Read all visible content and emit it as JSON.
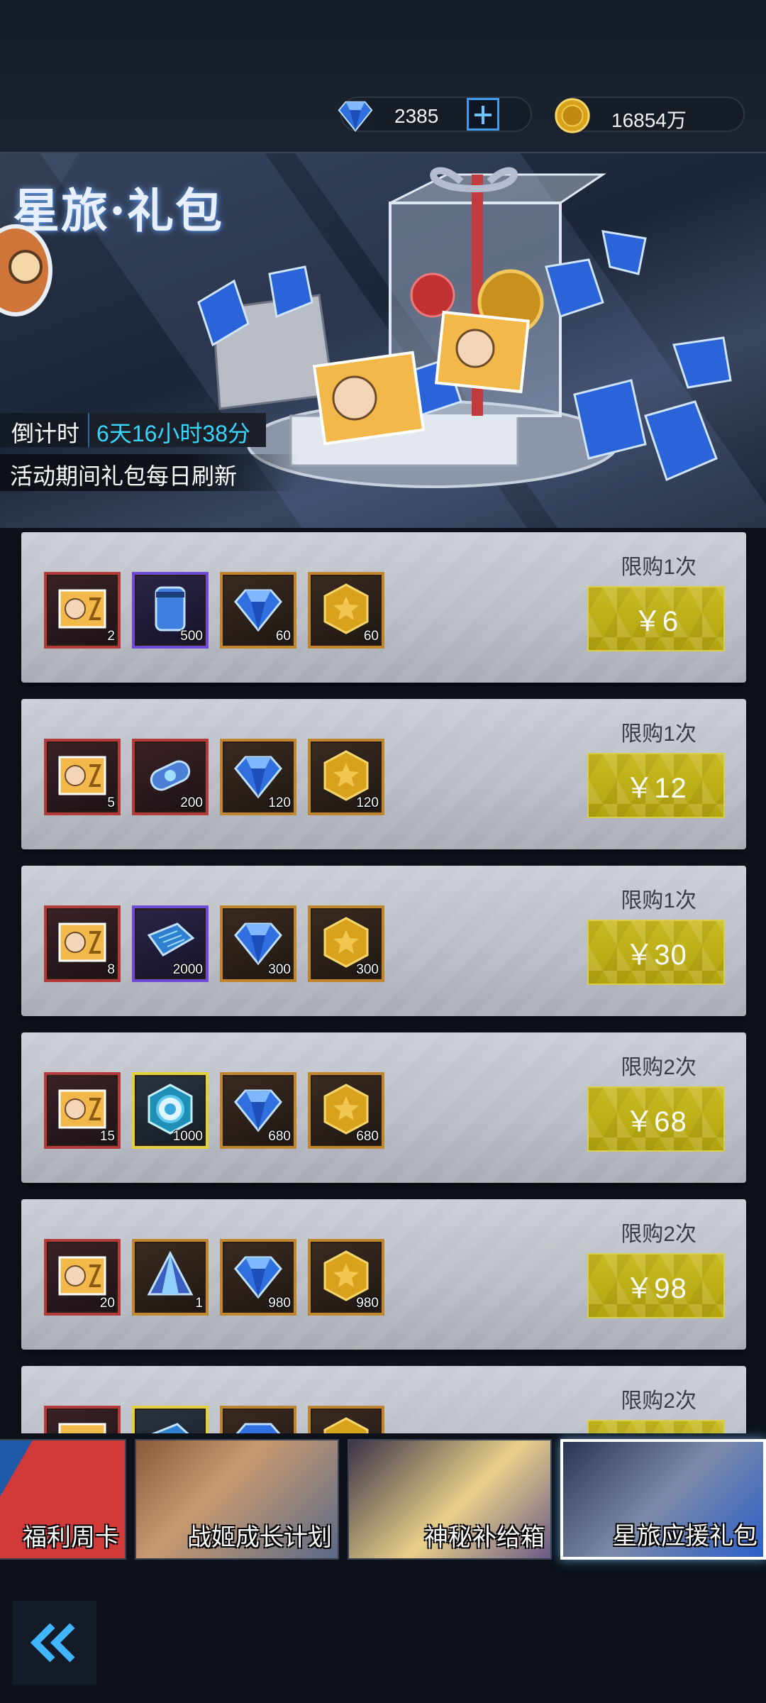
{
  "currency": {
    "gems": "2385",
    "gold": "16854万"
  },
  "banner": {
    "title": "星旅·礼包",
    "countdown_label": "倒计时",
    "countdown_value": "6天16小时38分",
    "refresh_note": "活动期间礼包每日刷新"
  },
  "packs": [
    {
      "limit": "限购1次",
      "price": "￥6",
      "items": [
        {
          "icon": "ticket-icon",
          "qty": "2"
        },
        {
          "icon": "energy-canister-icon",
          "qty": "500"
        },
        {
          "icon": "diamond-icon",
          "qty": "60"
        },
        {
          "icon": "gold-hexagon-icon",
          "qty": "60"
        }
      ]
    },
    {
      "limit": "限购1次",
      "price": "￥12",
      "items": [
        {
          "icon": "ticket-icon",
          "qty": "5"
        },
        {
          "icon": "capsule-icon",
          "qty": "200"
        },
        {
          "icon": "diamond-icon",
          "qty": "120"
        },
        {
          "icon": "gold-hexagon-icon",
          "qty": "120"
        }
      ]
    },
    {
      "limit": "限购1次",
      "price": "￥30",
      "items": [
        {
          "icon": "ticket-icon",
          "qty": "8"
        },
        {
          "icon": "chip-board-icon",
          "qty": "2000"
        },
        {
          "icon": "diamond-icon",
          "qty": "300"
        },
        {
          "icon": "gold-hexagon-icon",
          "qty": "300"
        }
      ]
    },
    {
      "limit": "限购2次",
      "price": "￥68",
      "items": [
        {
          "icon": "ticket-icon",
          "qty": "15"
        },
        {
          "icon": "core-orb-icon",
          "qty": "1000"
        },
        {
          "icon": "diamond-icon",
          "qty": "680"
        },
        {
          "icon": "gold-hexagon-icon",
          "qty": "680"
        }
      ]
    },
    {
      "limit": "限购2次",
      "price": "￥98",
      "items": [
        {
          "icon": "ticket-icon",
          "qty": "20"
        },
        {
          "icon": "crystal-prism-icon",
          "qty": "1"
        },
        {
          "icon": "diamond-icon",
          "qty": "980"
        },
        {
          "icon": "gold-hexagon-icon",
          "qty": "980"
        }
      ]
    },
    {
      "limit": "限购2次",
      "price": "",
      "items": [
        {
          "icon": "ticket-icon",
          "qty": ""
        },
        {
          "icon": "chip-board-icon",
          "qty": ""
        },
        {
          "icon": "diamond-icon",
          "qty": ""
        },
        {
          "icon": "gold-hexagon-icon",
          "qty": ""
        }
      ]
    }
  ],
  "tabs": [
    {
      "label": "福利周卡"
    },
    {
      "label": "战姬成长计划"
    },
    {
      "label": "神秘补给箱"
    },
    {
      "label": "星旅应援礼包"
    }
  ],
  "colors": {
    "price_button": "#c8ba22",
    "countdown_value": "#38d6ff",
    "active_tab_border": "#ffffff"
  }
}
